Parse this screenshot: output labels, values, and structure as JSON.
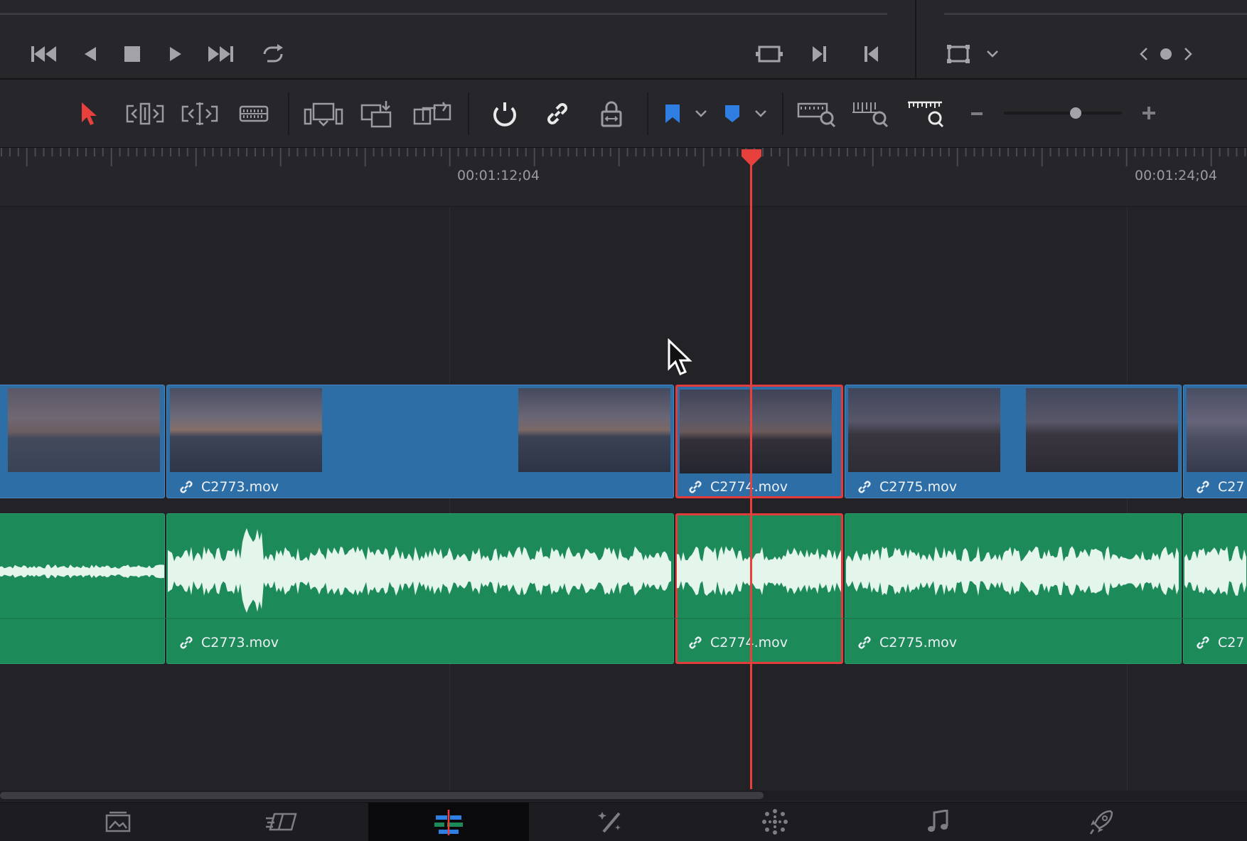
{
  "transport": {
    "buttons": [
      "skip-to-start",
      "play-reverse",
      "stop",
      "play",
      "skip-to-end",
      "loop"
    ],
    "right_buttons": [
      "match-frame",
      "next-edit",
      "previous-edit"
    ],
    "viewer_buttons": [
      "viewer-mode",
      "viewer-mode-dropdown",
      "prev",
      "dot",
      "next"
    ]
  },
  "toolbar": {
    "tools": [
      "selection",
      "trim-edit",
      "dynamic-trim",
      "blade",
      "insert-clip",
      "overwrite-clip",
      "replace-clip",
      "snapping",
      "linked-selection",
      "position-lock",
      "flag",
      "flag-dropdown",
      "marker",
      "marker-dropdown",
      "full-extent-zoom",
      "detail-zoom",
      "custom-zoom",
      "zoom-out",
      "zoom-slider",
      "zoom-in"
    ],
    "zoom_level": 0.61,
    "colors": {
      "selection": "#e8403d",
      "flag": "#2f7ee3",
      "marker": "#2f7ee3",
      "active": "#e9e9ec"
    }
  },
  "ruler": {
    "timecodes": [
      "00:01:12;04",
      "00:01:24;04"
    ]
  },
  "video_clips": [
    {
      "name": "",
      "selected": false
    },
    {
      "name": "C2773.mov",
      "selected": false
    },
    {
      "name": "C2774.mov",
      "selected": true
    },
    {
      "name": "C2775.mov",
      "selected": false
    },
    {
      "name": "C27",
      "selected": false
    }
  ],
  "audio_clips": [
    {
      "name": "",
      "selected": false
    },
    {
      "name": "C2773.mov",
      "selected": false
    },
    {
      "name": "C2774.mov",
      "selected": true
    },
    {
      "name": "C2775.mov",
      "selected": false
    },
    {
      "name": "C27",
      "selected": false
    }
  ],
  "page_tabs": [
    "media",
    "cut",
    "edit",
    "fusion",
    "color",
    "fairlight",
    "deliver"
  ],
  "active_page": "edit",
  "colors": {
    "video_clip": "#2d6ea6",
    "audio_clip": "#1d8a5a",
    "playhead": "#e8403d",
    "selection_border": "#e23b3b"
  }
}
